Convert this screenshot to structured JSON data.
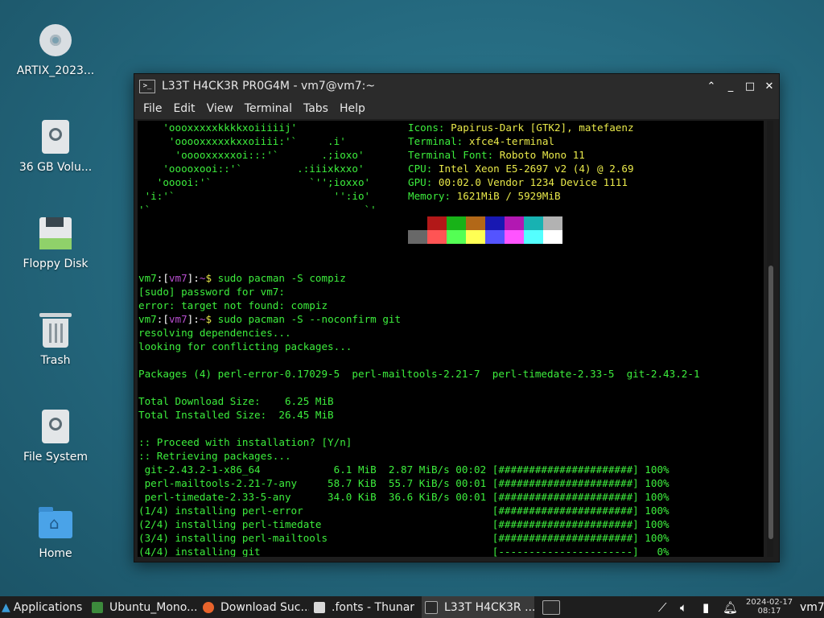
{
  "desktop": {
    "icons": [
      {
        "label": "ARTIX_2023..."
      },
      {
        "label": "36 GB Volu..."
      },
      {
        "label": "Floppy Disk"
      },
      {
        "label": "Trash"
      },
      {
        "label": "File System"
      },
      {
        "label": "Home"
      }
    ]
  },
  "window": {
    "title": "L33T H4CK3R PR0G4M - vm7@vm7:~",
    "icon_glyph": ">_",
    "controls": {
      "shade": "⌃",
      "minimize": "_",
      "maximize": "□",
      "close": "✕"
    },
    "menu": [
      "File",
      "Edit",
      "View",
      "Terminal",
      "Tabs",
      "Help"
    ]
  },
  "terminal": {
    "art": [
      "    'oooxxxxxkkkkxoiiiiij'",
      "     'ooooxxxxxkxxoiiii:'`     .i'",
      "      'ooooxxxxxoi:::'`       .;ioxo'",
      "    'ooooxooi::'`         .:iiixkxxo'",
      "   'ooooi:'`                `'';ioxxo'",
      " 'i:'`                          '':io'",
      "'`                                   `'"
    ],
    "info": [
      {
        "key": "Icons:",
        "value": " Papirus-Dark [GTK2], matefaenz"
      },
      {
        "key": "Terminal:",
        "value": " xfce4-terminal"
      },
      {
        "key": "Terminal Font:",
        "value": " Roboto Mono 11"
      },
      {
        "key": "CPU:",
        "value": " Intel Xeon E5-2697 v2 (4) @ 2.69"
      },
      {
        "key": "GPU:",
        "value": " 00:02.0 Vendor 1234 Device 1111"
      },
      {
        "key": "Memory:",
        "value": " 1621MiB / 5929MiB"
      }
    ],
    "palette_top": [
      "#000000",
      "#b21818",
      "#18b218",
      "#b26818",
      "#1818b2",
      "#b218b2",
      "#18b2b2",
      "#b2b2b2"
    ],
    "palette_bottom": [
      "#686868",
      "#ff5454",
      "#54ff54",
      "#ffff54",
      "#5454ff",
      "#ff54ff",
      "#54ffff",
      "#ffffff"
    ],
    "prompt": {
      "host": "vm7",
      "open": ":[",
      "user": "vm7",
      "close": "]:",
      "dir": "~",
      "sign": "$"
    },
    "cmd1": " sudo pacman -S compiz",
    "out1": "[sudo] password for vm7:",
    "out2": "error: target not found: compiz",
    "cmd2": " sudo pacman -S --noconfirm git",
    "out3": "resolving dependencies...",
    "out4": "looking for conflicting packages...",
    "packages": "Packages (4) perl-error-0.17029-5  perl-mailtools-2.21-7  perl-timedate-2.33-5  git-2.43.2-1",
    "download_size": "Total Download Size:    6.25 MiB",
    "installed_size": "Total Installed Size:  26.45 MiB",
    "proceed": ":: Proceed with installation? [Y/n]",
    "retrieving": ":: Retrieving packages...",
    "downloads": [
      " git-2.43.2-1-x86_64            6.1 MiB  2.87 MiB/s 00:02 [######################] 100%",
      " perl-mailtools-2.21-7-any     58.7 KiB  55.7 KiB/s 00:01 [######################] 100%",
      " perl-timedate-2.33-5-any      34.0 KiB  36.6 KiB/s 00:01 [######################] 100%"
    ],
    "installs": [
      "(1/4) installing perl-error                               [######################] 100%",
      "(2/4) installing perl-timedate                            [######################] 100%",
      "(3/4) installing perl-mailtools                           [######################] 100%",
      "(4/4) installing git                                      [----------------------]   0%"
    ]
  },
  "taskbar": {
    "applications": "Applications",
    "tasks": [
      {
        "label": "Ubuntu_Mono...",
        "color": "#3c8a3c"
      },
      {
        "label": "Download Suc...",
        "color": "#e8642c"
      },
      {
        "label": ".fonts - Thunar",
        "color": "#d8d8d8"
      },
      {
        "label": "L33T H4CK3R ...",
        "color": "#2a2a2a"
      }
    ],
    "clock_date": "2024-02-17",
    "clock_time": "08:17",
    "user": "vm7"
  }
}
